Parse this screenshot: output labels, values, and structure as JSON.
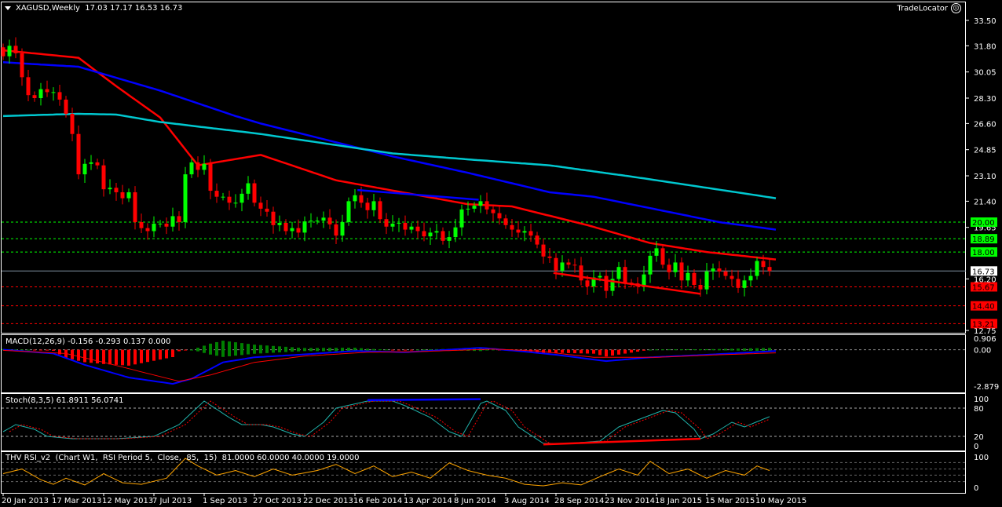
{
  "header": {
    "symbol": "XAGUSD,Weekly",
    "ohlc": "17.03 17.17 16.53 16.73",
    "tradelocator": "TradeLocator"
  },
  "colors": {
    "bull": "#00ff00",
    "bear": "#ff0000",
    "ma_fast": "#ff0000",
    "ma_mid": "#0000ff",
    "ma_slow": "#00c8d0",
    "rsi": "#ffa500"
  },
  "chart_data": [
    {
      "type": "candlestick",
      "title": "XAGUSD,Weekly",
      "ylim": [
        12.75,
        33.5
      ],
      "yticks": [
        "33.50",
        "31.80",
        "30.05",
        "28.30",
        "26.60",
        "24.85",
        "23.10",
        "21.40",
        "19.65",
        "16.20",
        "12.75"
      ],
      "xticks": [
        {
          "i": 0,
          "label": "20 Jan 2013"
        },
        {
          "i": 8,
          "label": "17 Mar 2013"
        },
        {
          "i": 16,
          "label": "12 May 2013"
        },
        {
          "i": 24,
          "label": "7 Jul 2013"
        },
        {
          "i": 32,
          "label": "1 Sep 2013"
        },
        {
          "i": 40,
          "label": "27 Oct 2013"
        },
        {
          "i": 48,
          "label": "22 Dec 2013"
        },
        {
          "i": 56,
          "label": "16 Feb 2014"
        },
        {
          "i": 64,
          "label": "13 Apr 2014"
        },
        {
          "i": 72,
          "label": "8 Jun 2014"
        },
        {
          "i": 80,
          "label": "3 Aug 2014"
        },
        {
          "i": 88,
          "label": "28 Sep 2014"
        },
        {
          "i": 96,
          "label": "23 Nov 2014"
        },
        {
          "i": 104,
          "label": "18 Jan 2015"
        },
        {
          "i": 112,
          "label": "15 Mar 2015"
        },
        {
          "i": 120,
          "label": "10 May 2015"
        }
      ],
      "first_open": 31.7,
      "closes": [
        31.1,
        31.8,
        31.3,
        29.7,
        28.5,
        28.3,
        28.9,
        28.7,
        28.7,
        28.2,
        27.25,
        25.9,
        23.2,
        23.9,
        24.0,
        23.8,
        22.2,
        22.3,
        22.0,
        21.6,
        22.0,
        20.0,
        19.6,
        19.4,
        19.9,
        19.9,
        19.7,
        20.4,
        20.0,
        23.2,
        24.0,
        23.5,
        23.9,
        22.1,
        21.7,
        21.7,
        21.3,
        21.3,
        21.9,
        22.6,
        21.3,
        20.9,
        20.7,
        19.8,
        19.95,
        19.4,
        19.6,
        19.3,
        20.05,
        20.1,
        20.1,
        20.3,
        19.85,
        19.1,
        20.0,
        21.4,
        21.8,
        21.3,
        20.8,
        21.4,
        20.2,
        19.7,
        19.9,
        19.95,
        19.5,
        19.7,
        19.4,
        19.05,
        19.3,
        19.4,
        18.75,
        19.0,
        19.65,
        20.85,
        20.9,
        21.1,
        21.4,
        20.85,
        20.6,
        20.25,
        19.8,
        19.5,
        19.3,
        19.4,
        19.1,
        18.5,
        17.7,
        17.6,
        16.75,
        17.3,
        17.15,
        17.1,
        16.1,
        15.7,
        16.3,
        16.4,
        15.4,
        16.2,
        17.0,
        15.95,
        15.9,
        15.7,
        16.5,
        17.75,
        18.25,
        17.15,
        16.65,
        17.3,
        16.1,
        16.6,
        15.8,
        15.5,
        16.7,
        16.9,
        16.7,
        16.4,
        16.2,
        15.6,
        16.1,
        16.4,
        17.4,
        17.0,
        16.73
      ],
      "moving_averages": [
        {
          "name": "ma_fast",
          "color": "#ff0000",
          "points": [
            [
              0,
              31.5
            ],
            [
              12,
              31.0
            ],
            [
              18,
              29.1
            ],
            [
              25,
              27.0
            ],
            [
              31,
              23.8
            ],
            [
              41,
              24.5
            ],
            [
              53,
              22.8
            ],
            [
              74,
              21.2
            ],
            [
              81,
              21.05
            ],
            [
              93,
              19.8
            ],
            [
              103,
              18.6
            ],
            [
              112,
              18.0
            ],
            [
              123,
              17.5
            ]
          ]
        },
        {
          "name": "ma_mid",
          "color": "#0000ff",
          "points": [
            [
              0,
              30.7
            ],
            [
              12,
              30.4
            ],
            [
              25,
              28.8
            ],
            [
              37,
              27.1
            ],
            [
              41,
              26.6
            ],
            [
              62,
              24.4
            ],
            [
              74,
              23.3
            ],
            [
              87,
              22.0
            ],
            [
              94,
              21.7
            ],
            [
              114,
              20.0
            ],
            [
              123,
              19.5
            ]
          ]
        },
        {
          "name": "ma_slow",
          "color": "#00c8d0",
          "points": [
            [
              0,
              27.1
            ],
            [
              12,
              27.25
            ],
            [
              18,
              27.2
            ],
            [
              25,
              26.7
            ],
            [
              41,
              25.9
            ],
            [
              62,
              24.6
            ],
            [
              74,
              24.2
            ],
            [
              87,
              23.8
            ],
            [
              100,
              23.05
            ],
            [
              112,
              22.3
            ],
            [
              123,
              21.6
            ]
          ]
        }
      ],
      "levels": [
        {
          "price": 20.0,
          "label": "20.00",
          "color": "#00ff00",
          "style": "dashed"
        },
        {
          "price": 18.89,
          "label": "18.89",
          "color": "#00ff00",
          "style": "dashed"
        },
        {
          "price": 18.0,
          "label": "18.00",
          "color": "#00ff00",
          "style": "dashed"
        },
        {
          "price": 16.73,
          "label": "16.73",
          "color": "#ffffff",
          "style": "current"
        },
        {
          "price": 15.67,
          "label": "15.67",
          "color": "#ff0000",
          "style": "dashed"
        },
        {
          "price": 14.4,
          "label": "14.40",
          "color": "#ff0000",
          "style": "dashed"
        },
        {
          "price": 13.21,
          "label": "13.21",
          "color": "#ff0000",
          "style": "dashed"
        }
      ],
      "trendlines": [
        {
          "name": "resistance",
          "color": "#0000ff",
          "from": [
            56.4,
            22.15
          ],
          "to": [
            75.7,
            21.5
          ]
        },
        {
          "name": "support",
          "color": "#ff0000",
          "from": [
            87.6,
            16.6
          ],
          "to": [
            111,
            15.2
          ]
        }
      ]
    },
    {
      "type": "macd",
      "label": "MACD(12,26,9) -0.156 -0.293 0.137 0.000",
      "ylim": [
        -2.879,
        0.906
      ],
      "yticks": [
        "0.906",
        "0.00",
        "-2.879"
      ],
      "macd": [
        [
          0,
          0.0
        ],
        [
          8,
          -0.3
        ],
        [
          13,
          -1.2
        ],
        [
          20,
          -2.2
        ],
        [
          27,
          -2.7
        ],
        [
          30,
          -2.3
        ],
        [
          35,
          -1.0
        ],
        [
          40,
          -0.6
        ],
        [
          47,
          -0.4
        ],
        [
          56,
          -0.1
        ],
        [
          64,
          -0.2
        ],
        [
          76,
          0.15
        ],
        [
          82,
          -0.1
        ],
        [
          88,
          -0.4
        ],
        [
          96,
          -0.9
        ],
        [
          103,
          -0.6
        ],
        [
          112,
          -0.4
        ],
        [
          123,
          -0.1
        ]
      ],
      "signal": [
        [
          0,
          -0.05
        ],
        [
          10,
          -0.3
        ],
        [
          16,
          -1.0
        ],
        [
          24,
          -2.0
        ],
        [
          28,
          -2.5
        ],
        [
          33,
          -2.0
        ],
        [
          40,
          -1.0
        ],
        [
          48,
          -0.5
        ],
        [
          58,
          -0.2
        ],
        [
          66,
          -0.15
        ],
        [
          78,
          0.05
        ],
        [
          85,
          -0.1
        ],
        [
          94,
          -0.6
        ],
        [
          104,
          -0.6
        ],
        [
          114,
          -0.4
        ],
        [
          123,
          -0.25
        ]
      ]
    },
    {
      "type": "stochastic",
      "label": "Stoch(8,3,5) 61.8911 56.0741",
      "ylim": [
        0,
        100
      ],
      "yticks": [
        "100",
        "80",
        "20",
        "0"
      ],
      "levels": [
        80,
        20
      ],
      "main": [
        [
          0,
          30
        ],
        [
          2,
          45
        ],
        [
          5,
          35
        ],
        [
          7,
          20
        ],
        [
          11,
          15
        ],
        [
          18,
          15
        ],
        [
          24,
          20
        ],
        [
          28,
          45
        ],
        [
          32,
          95
        ],
        [
          36,
          60
        ],
        [
          38,
          45
        ],
        [
          41,
          45
        ],
        [
          43,
          40
        ],
        [
          46,
          25
        ],
        [
          48,
          20
        ],
        [
          51,
          50
        ],
        [
          53,
          80
        ],
        [
          58,
          95
        ],
        [
          62,
          95
        ],
        [
          64,
          85
        ],
        [
          68,
          60
        ],
        [
          71,
          30
        ],
        [
          73,
          20
        ],
        [
          76,
          90
        ],
        [
          77,
          95
        ],
        [
          80,
          75
        ],
        [
          82,
          40
        ],
        [
          86,
          5
        ],
        [
          90,
          5
        ],
        [
          95,
          10
        ],
        [
          98,
          40
        ],
        [
          102,
          60
        ],
        [
          105,
          75
        ],
        [
          107,
          70
        ],
        [
          110,
          35
        ],
        [
          111,
          15
        ],
        [
          113,
          25
        ],
        [
          116,
          50
        ],
        [
          118,
          40
        ],
        [
          122,
          62
        ]
      ],
      "trendlines": [
        {
          "color": "#0000ff",
          "from": [
            58,
            97
          ],
          "to": [
            76,
            99
          ]
        },
        {
          "color": "#ff0000",
          "from": [
            86,
            3
          ],
          "to": [
            111,
            15
          ]
        }
      ]
    },
    {
      "type": "rsi",
      "label": "THV RSI_v2  (Chart W1,  RSI Period 5,  Close,  85,  15)  81.0000 60.0000 40.0000 19.0000",
      "ylim": [
        0,
        100
      ],
      "yticks": [
        "100",
        "0"
      ],
      "levels": [
        81,
        60,
        40,
        19
      ],
      "values": [
        [
          0,
          45
        ],
        [
          3,
          60
        ],
        [
          6,
          25
        ],
        [
          8,
          10
        ],
        [
          10,
          30
        ],
        [
          13,
          8
        ],
        [
          16,
          45
        ],
        [
          19,
          15
        ],
        [
          22,
          10
        ],
        [
          26,
          30
        ],
        [
          29,
          95
        ],
        [
          31,
          70
        ],
        [
          34,
          40
        ],
        [
          37,
          55
        ],
        [
          40,
          35
        ],
        [
          43,
          60
        ],
        [
          46,
          40
        ],
        [
          50,
          55
        ],
        [
          53,
          75
        ],
        [
          56,
          45
        ],
        [
          59,
          70
        ],
        [
          62,
          35
        ],
        [
          65,
          50
        ],
        [
          68,
          30
        ],
        [
          71,
          80
        ],
        [
          74,
          55
        ],
        [
          77,
          40
        ],
        [
          80,
          30
        ],
        [
          83,
          10
        ],
        [
          86,
          5
        ],
        [
          89,
          15
        ],
        [
          92,
          8
        ],
        [
          95,
          35
        ],
        [
          98,
          60
        ],
        [
          101,
          40
        ],
        [
          103,
          85
        ],
        [
          106,
          45
        ],
        [
          109,
          60
        ],
        [
          112,
          30
        ],
        [
          115,
          55
        ],
        [
          118,
          40
        ],
        [
          120,
          70
        ],
        [
          122,
          55
        ]
      ]
    }
  ]
}
